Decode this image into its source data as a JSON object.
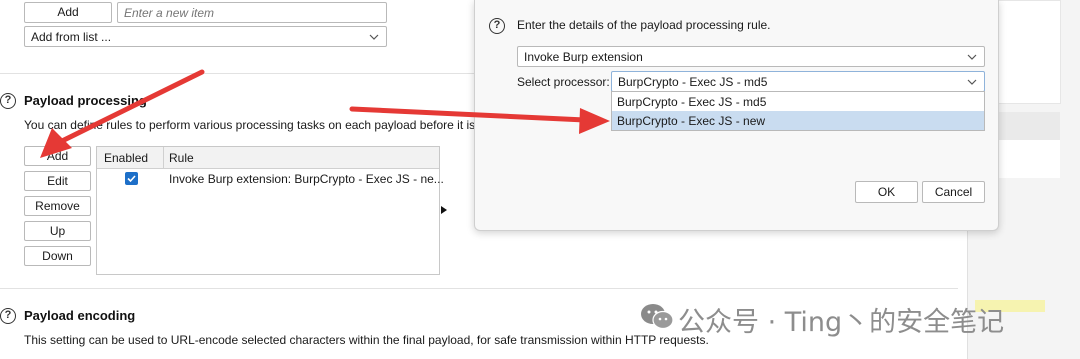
{
  "top": {
    "add_label": "Add",
    "new_item_placeholder": "Enter a new item",
    "add_from_list_value": "Add from list ..."
  },
  "payload_processing": {
    "title": "Payload processing",
    "description": "You can define rules to perform various processing tasks on each payload before it is",
    "buttons": [
      "Add",
      "Edit",
      "Remove",
      "Up",
      "Down"
    ],
    "table": {
      "columns": [
        "Enabled",
        "Rule"
      ],
      "rows": [
        {
          "enabled": true,
          "rule": "Invoke Burp extension: BurpCrypto - Exec JS - ne..."
        }
      ]
    }
  },
  "payload_encoding": {
    "title": "Payload encoding",
    "description": "This setting can be used to URL-encode selected characters within the final payload, for safe transmission within HTTP requests."
  },
  "dialog": {
    "prompt": "Enter the details of the payload processing rule.",
    "rule_type": "Invoke Burp extension",
    "processor_label": "Select processor:",
    "processor_value": "BurpCrypto - Exec JS - md5",
    "options": [
      "BurpCrypto - Exec JS - md5",
      "BurpCrypto - Exec JS - new"
    ],
    "ok_label": "OK",
    "cancel_label": "Cancel"
  },
  "watermark": {
    "text": "公众号 · Ting丶的安全笔记"
  },
  "colors": {
    "accent": "#1d6fc8",
    "selected_option": "#c9dcf0",
    "arrow": "#e53935"
  }
}
